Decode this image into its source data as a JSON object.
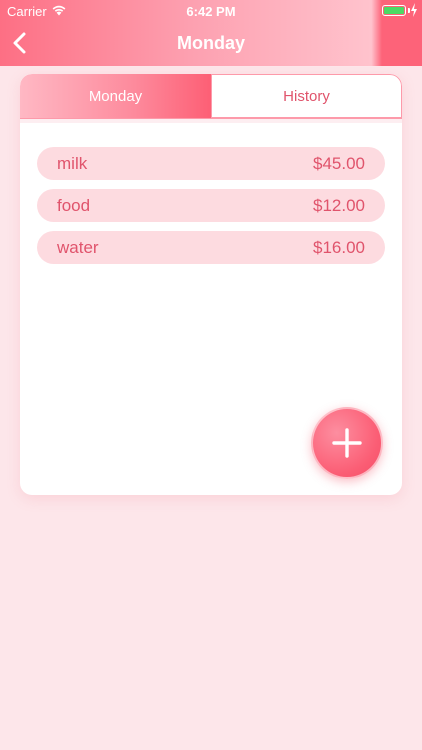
{
  "status_bar": {
    "carrier": "Carrier",
    "time": "6:42 PM"
  },
  "nav": {
    "title": "Monday"
  },
  "tabs": [
    {
      "label": "Monday",
      "active": true
    },
    {
      "label": "History",
      "active": false
    }
  ],
  "expenses": [
    {
      "name": "milk",
      "amount": "$45.00"
    },
    {
      "name": "food",
      "amount": "$12.00"
    },
    {
      "name": "water",
      "amount": "$16.00"
    }
  ],
  "colors": {
    "accent": "#fd5f75",
    "text_pink": "#e0546c",
    "item_bg": "#fddbe0",
    "page_bg": "#fde6ea"
  },
  "icons": {
    "back": "chevron-left-icon",
    "add": "plus-icon",
    "wifi": "wifi-icon",
    "battery": "battery-icon"
  }
}
